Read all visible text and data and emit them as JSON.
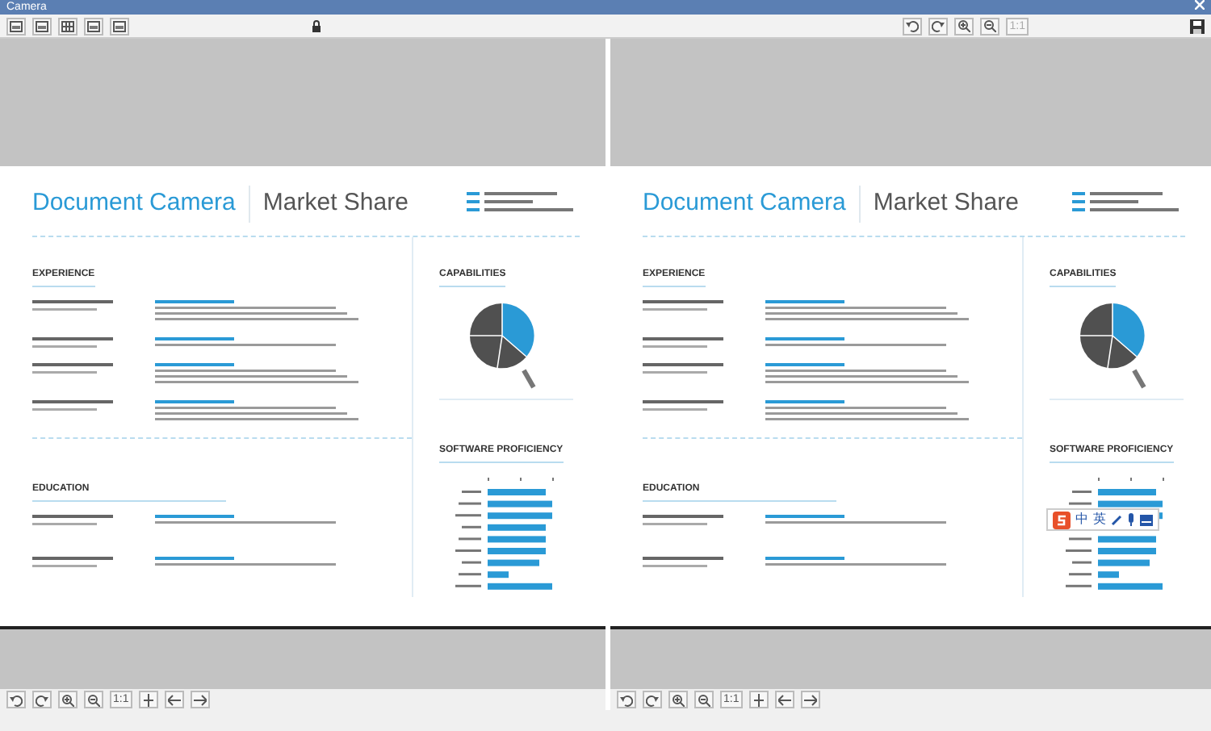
{
  "window": {
    "title": "Camera"
  },
  "toolbar": {
    "zoom_reset_label": "1:1"
  },
  "panels": [
    {
      "title": "Document Camera",
      "subtitle": "Market Share",
      "sections": [
        "EXPERIENCE",
        "EDUCATION"
      ],
      "side_sections": [
        "CAPABILITIES",
        "SOFTWARE PROFICIENCY"
      ],
      "bottom_toolbar": {
        "zoom_reset_label": "1:1"
      }
    },
    {
      "title": "Document Camera",
      "subtitle": "Market Share",
      "sections": [
        "EXPERIENCE",
        "EDUCATION"
      ],
      "side_sections": [
        "CAPABILITIES",
        "SOFTWARE PROFICIENCY"
      ],
      "bottom_toolbar": {
        "zoom_reset_label": "1:1"
      },
      "ime_toolbar": {
        "labels": [
          "中",
          "英"
        ]
      }
    }
  ]
}
